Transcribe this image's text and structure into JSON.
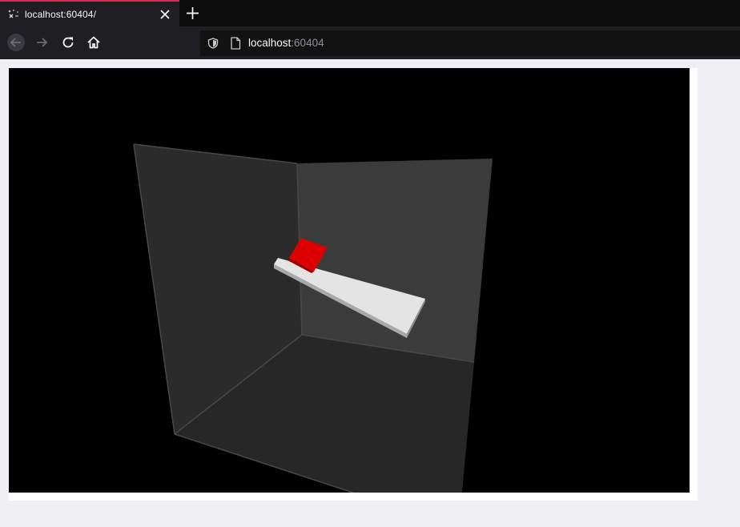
{
  "browser": {
    "tab": {
      "title": "localhost:60404/",
      "favicon_icon": "loading-icon",
      "close_icon": "close-icon"
    },
    "new_tab_icon": "plus-icon",
    "nav": {
      "back_icon": "arrow-left-icon",
      "forward_icon": "arrow-right-icon",
      "reload_icon": "reload-icon",
      "home_icon": "home-icon"
    },
    "url": {
      "host": "localhost",
      "port": ":60404",
      "shield_icon": "shield-icon",
      "page_icon": "page-icon"
    },
    "accent_color": "#e22850"
  },
  "scene": {
    "background": "#000000",
    "box_wall_colors": [
      "#2a2a2a",
      "#3b3b3b",
      "#262626"
    ],
    "paddle_color": "#d6d6d6",
    "block_color": "#dd0000"
  }
}
